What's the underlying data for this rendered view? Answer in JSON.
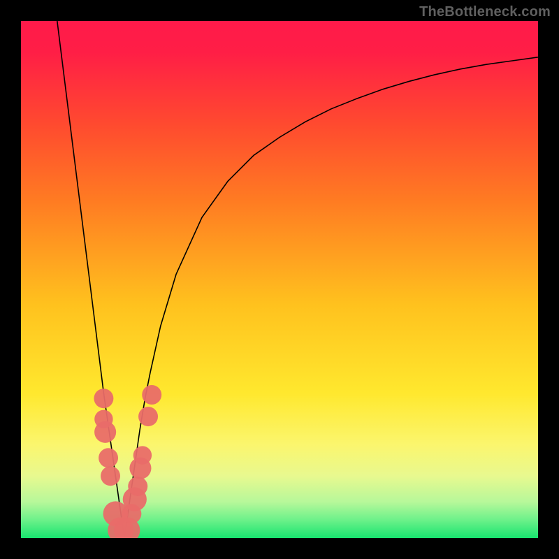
{
  "watermark": "TheBottleneck.com",
  "colors": {
    "gradient_stops": [
      {
        "offset": 0,
        "color": "#ff1a4a"
      },
      {
        "offset": 0.06,
        "color": "#ff1e46"
      },
      {
        "offset": 0.2,
        "color": "#ff4a2f"
      },
      {
        "offset": 0.35,
        "color": "#ff7c22"
      },
      {
        "offset": 0.55,
        "color": "#ffc21e"
      },
      {
        "offset": 0.72,
        "color": "#ffe82e"
      },
      {
        "offset": 0.82,
        "color": "#fbf66e"
      },
      {
        "offset": 0.88,
        "color": "#e8f98f"
      },
      {
        "offset": 0.93,
        "color": "#b7f89a"
      },
      {
        "offset": 0.965,
        "color": "#6cf18a"
      },
      {
        "offset": 1.0,
        "color": "#18e46f"
      }
    ],
    "curve": "#000000",
    "dot": "#e96b69",
    "frame": "#000000",
    "watermark_text": "#606060"
  },
  "chart_data": {
    "type": "line",
    "title": "",
    "xlabel": "",
    "ylabel": "",
    "xlim": [
      0,
      100
    ],
    "ylim": [
      0,
      100
    ],
    "notch_x": 20,
    "series": [
      {
        "name": "bottleneck-curve",
        "x": [
          7,
          8,
          9,
          10,
          11,
          12,
          13,
          14,
          15,
          16,
          17,
          18,
          19,
          19.5,
          20,
          20.5,
          21,
          22,
          23,
          24,
          25,
          27,
          30,
          35,
          40,
          45,
          50,
          55,
          60,
          65,
          70,
          75,
          80,
          85,
          90,
          95,
          100
        ],
        "y": [
          100,
          92,
          84,
          76,
          68,
          60,
          52,
          44,
          36,
          28,
          21,
          14,
          7,
          3.5,
          0,
          3.5,
          7,
          14,
          21,
          27,
          32,
          41,
          51,
          62,
          69,
          74,
          77.5,
          80.5,
          83,
          85,
          86.8,
          88.3,
          89.6,
          90.7,
          91.6,
          92.3,
          93
        ]
      }
    ],
    "scatter_points": {
      "name": "highlighted-points",
      "points": [
        {
          "x": 16.0,
          "y": 27.0,
          "r": 1.8
        },
        {
          "x": 16.0,
          "y": 23.0,
          "r": 1.7
        },
        {
          "x": 16.3,
          "y": 20.5,
          "r": 2.0
        },
        {
          "x": 16.9,
          "y": 15.5,
          "r": 1.8
        },
        {
          "x": 17.3,
          "y": 12.0,
          "r": 1.8
        },
        {
          "x": 18.3,
          "y": 4.7,
          "r": 2.3
        },
        {
          "x": 19.3,
          "y": 1.5,
          "r": 2.4
        },
        {
          "x": 20.5,
          "y": 1.5,
          "r": 2.4
        },
        {
          "x": 21.4,
          "y": 4.7,
          "r": 1.8
        },
        {
          "x": 22.0,
          "y": 7.5,
          "r": 2.2
        },
        {
          "x": 22.6,
          "y": 10.0,
          "r": 1.8
        },
        {
          "x": 23.1,
          "y": 13.5,
          "r": 2.0
        },
        {
          "x": 23.5,
          "y": 16.0,
          "r": 1.7
        },
        {
          "x": 24.6,
          "y": 23.5,
          "r": 1.8
        },
        {
          "x": 25.3,
          "y": 27.7,
          "r": 1.8
        }
      ]
    }
  }
}
